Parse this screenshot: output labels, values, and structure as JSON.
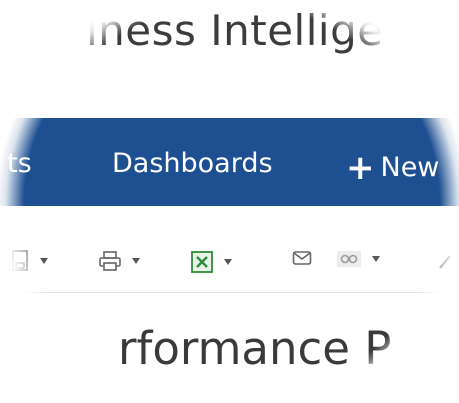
{
  "header": {
    "title": "iness Intellige"
  },
  "nav": {
    "items": [
      {
        "label": "ts"
      },
      {
        "label": "Dashboards"
      },
      {
        "label": "New",
        "icon": "plus-icon"
      }
    ]
  },
  "toolbar": {
    "buttons": [
      {
        "icon": "save-icon"
      },
      {
        "icon": "print-icon"
      },
      {
        "icon": "excel-export-icon",
        "color": "#2e8b3a"
      },
      {
        "icon": "email-icon"
      },
      {
        "icon": "link-icon"
      },
      {
        "icon": "edit-icon"
      }
    ]
  },
  "report": {
    "title": "rformance P"
  },
  "colors": {
    "nav_background": "#1d4f91",
    "nav_text": "#ffffff",
    "excel_green": "#2e8b3a"
  }
}
